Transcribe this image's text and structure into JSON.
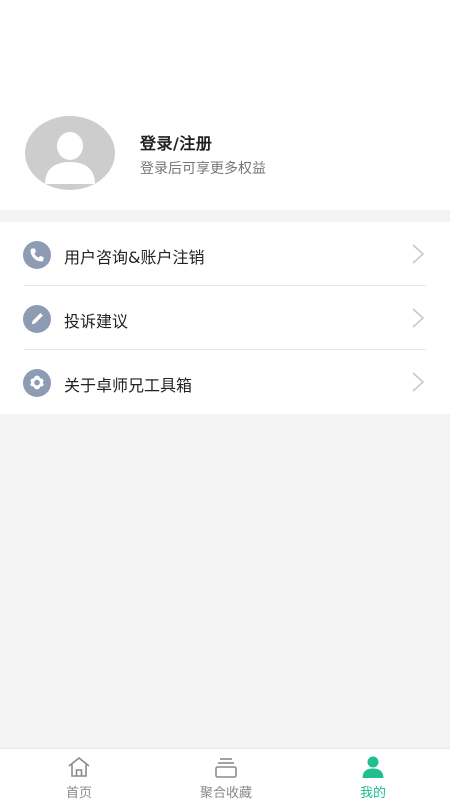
{
  "profile": {
    "login_title": "登录/注册",
    "login_subtitle": "登录后可享更多权益",
    "avatar_icon": "user-avatar-icon"
  },
  "menu": {
    "items": [
      {
        "label": "用户咨询&账户注销",
        "icon": "phone-icon"
      },
      {
        "label": "投诉建议",
        "icon": "pencil-icon"
      },
      {
        "label": "关于卓师兄工具箱",
        "icon": "gear-icon"
      }
    ]
  },
  "tabbar": {
    "tabs": [
      {
        "label": "首页",
        "icon": "home-icon",
        "active": false
      },
      {
        "label": "聚合收藏",
        "icon": "collection-icon",
        "active": false
      },
      {
        "label": "我的",
        "icon": "person-icon",
        "active": true
      }
    ],
    "active_color": "#1fbf8f",
    "inactive_color": "#8a8a8a"
  },
  "colors": {
    "menu_icon_bg": "#8d9bb3",
    "avatar_bg": "#cdcdcd",
    "page_bg": "#f3f3f3"
  }
}
